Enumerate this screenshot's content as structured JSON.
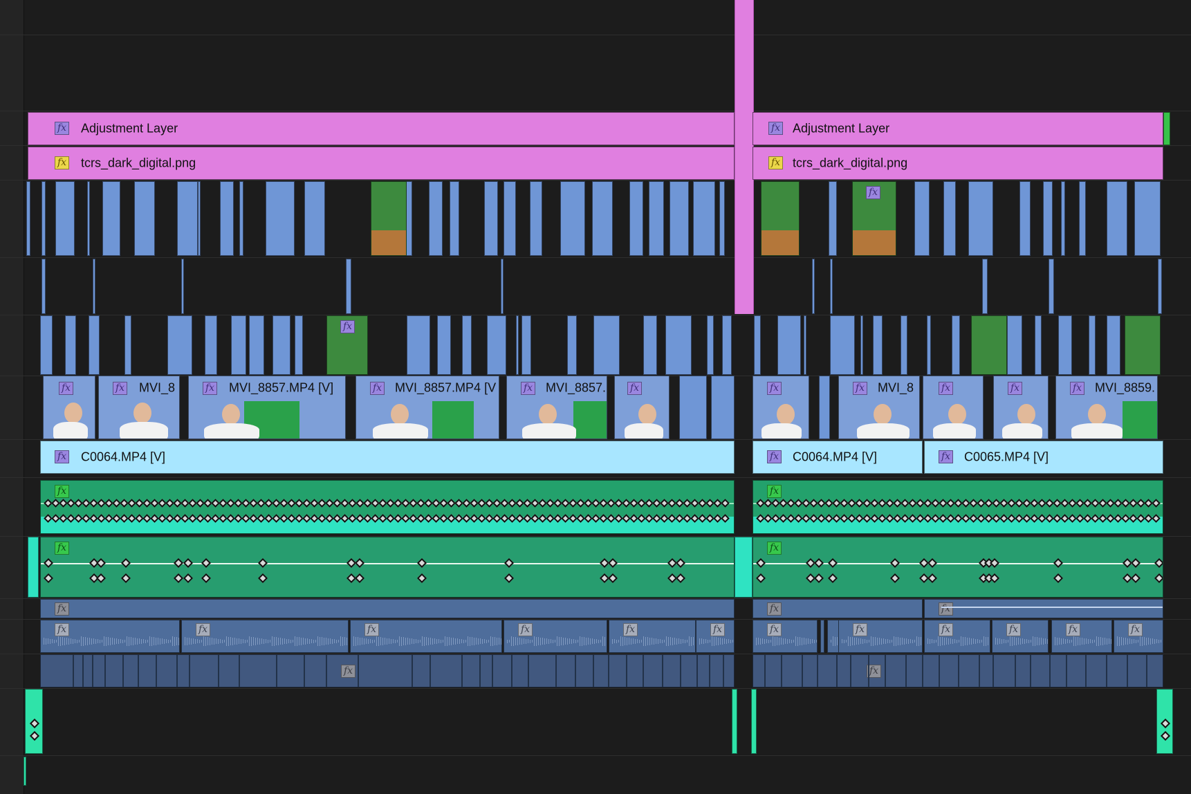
{
  "app": "Video editor timeline",
  "colors": {
    "background": "#1c1c1c",
    "adjustment": "#e07fe0",
    "video_clip": "#7e9fd8",
    "nested_clip": "#a8e6ff",
    "audio_clip": "#23a16c",
    "audio_blue": "#4e6d9b"
  },
  "tracks": {
    "v_adjust": {
      "left_label": "Adjustment Layer",
      "right_label": "Adjustment Layer"
    },
    "v_png": {
      "left_label": "tcrs_dark_digital.png",
      "right_label": "tcrs_dark_digital.png"
    },
    "v_main": {
      "clip_1": "MVI_8",
      "clip_2": "MVI_8857.MP4 [V]",
      "clip_3": "MVI_8857.MP4 [V",
      "clip_4": "MVI_8857.",
      "clip_5": "MVI_8",
      "clip_6": "MVI_8859."
    },
    "v_base": {
      "left_label": "C0064.MP4 [V]",
      "mid_label": "C0064.MP4 [V]",
      "right_label": "C0065.MP4 [V]"
    }
  },
  "icons": {
    "fx_badge": "fx-icon",
    "keyframe": "keyframe-icon"
  }
}
